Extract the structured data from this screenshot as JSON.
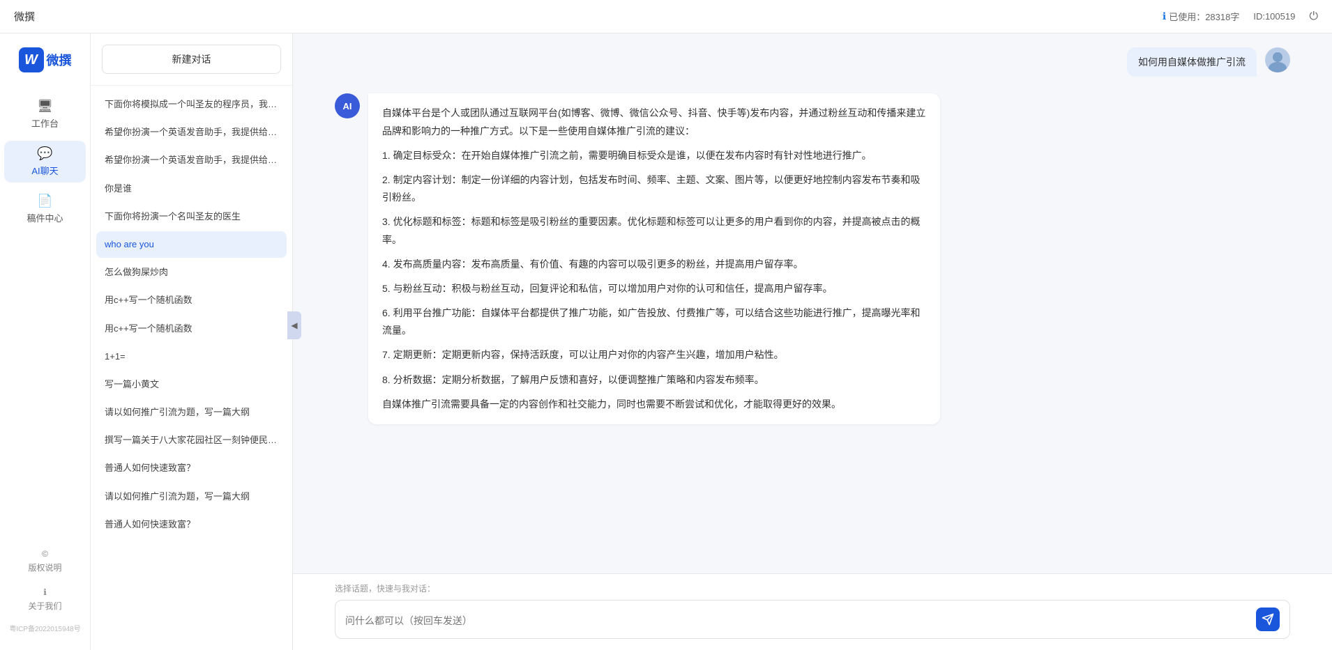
{
  "topbar": {
    "title": "微撰",
    "usage_label": "已使用：28318字",
    "id_label": "ID:100519",
    "usage_icon": "ℹ"
  },
  "logo": {
    "w": "W",
    "text": "微撰"
  },
  "nav": {
    "items": [
      {
        "id": "workspace",
        "icon": "🖥",
        "label": "工作台"
      },
      {
        "id": "ai-chat",
        "icon": "💬",
        "label": "AI聊天"
      },
      {
        "id": "drafts",
        "icon": "📄",
        "label": "稿件中心"
      }
    ],
    "bottom_items": [
      {
        "id": "copyright",
        "icon": "©",
        "label": "版权说明"
      },
      {
        "id": "about",
        "icon": "ℹ",
        "label": "关于我们"
      }
    ],
    "beian": "粤ICP备2022015948号"
  },
  "sidebar": {
    "new_chat_label": "新建对话",
    "chat_items": [
      {
        "id": 1,
        "text": "下面你将模拟成一个叫圣友的程序员，我说...",
        "active": false
      },
      {
        "id": 2,
        "text": "希望你扮演一个英语发音助手，我提供给你...",
        "active": false
      },
      {
        "id": 3,
        "text": "希望你扮演一个英语发音助手，我提供给你...",
        "active": false
      },
      {
        "id": 4,
        "text": "你是谁",
        "active": false
      },
      {
        "id": 5,
        "text": "下面你将扮演一个名叫圣友的医生",
        "active": false
      },
      {
        "id": 6,
        "text": "who are you",
        "active": true
      },
      {
        "id": 7,
        "text": "怎么做狗屎炒肉",
        "active": false
      },
      {
        "id": 8,
        "text": "用c++写一个随机函数",
        "active": false
      },
      {
        "id": 9,
        "text": "用c++写一个随机函数",
        "active": false
      },
      {
        "id": 10,
        "text": "1+1=",
        "active": false
      },
      {
        "id": 11,
        "text": "写一篇小黄文",
        "active": false
      },
      {
        "id": 12,
        "text": "请以如何推广引流为题，写一篇大纲",
        "active": false
      },
      {
        "id": 13,
        "text": "撰写一篇关于八大家花园社区一刻钟便民生...",
        "active": false
      },
      {
        "id": 14,
        "text": "普通人如何快速致富？",
        "active": false
      },
      {
        "id": 15,
        "text": "请以如何推广引流为题，写一篇大纲",
        "active": false
      },
      {
        "id": 16,
        "text": "普通人如何快速致富？",
        "active": false
      }
    ]
  },
  "chat": {
    "user_message": "如何用自媒体做推广引流",
    "ai_response_paragraphs": [
      "自媒体平台是个人或团队通过互联网平台(如博客、微博、微信公众号、抖音、快手等)发布内容，并通过粉丝互动和传播来建立品牌和影响力的一种推广方式。以下是一些使用自媒体推广引流的建议：",
      "1. 确定目标受众：在开始自媒体推广引流之前，需要明确目标受众是谁，以便在发布内容时有针对性地进行推广。",
      "2. 制定内容计划：制定一份详细的内容计划，包括发布时间、频率、主题、文案、图片等，以便更好地控制内容发布节奏和吸引粉丝。",
      "3. 优化标题和标签：标题和标签是吸引粉丝的重要因素。优化标题和标签可以让更多的用户看到你的内容，并提高被点击的概率。",
      "4. 发布高质量内容：发布高质量、有价值、有趣的内容可以吸引更多的粉丝，并提高用户留存率。",
      "5. 与粉丝互动：积极与粉丝互动，回复评论和私信，可以增加用户对你的认可和信任，提高用户留存率。",
      "6. 利用平台推广功能：自媒体平台都提供了推广功能，如广告投放、付费推广等，可以结合这些功能进行推广，提高曝光率和流量。",
      "7. 定期更新：定期更新内容，保持活跃度，可以让用户对你的内容产生兴趣，增加用户粘性。",
      "8. 分析数据：定期分析数据，了解用户反馈和喜好，以便调整推广策略和内容发布频率。",
      "自媒体推广引流需要具备一定的内容创作和社交能力，同时也需要不断尝试和优化，才能取得更好的效果。"
    ],
    "input_placeholder": "问什么都可以（按回车发送）",
    "quick_prompt_label": "选择话题，快速与我对话："
  }
}
